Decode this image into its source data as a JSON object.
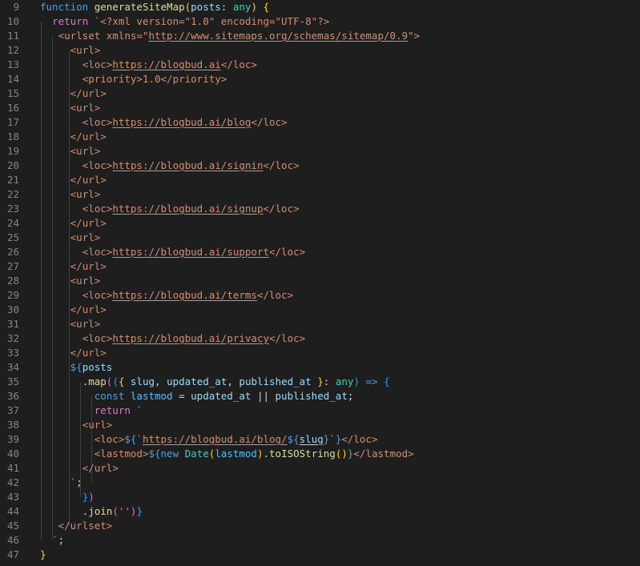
{
  "colors": {
    "keyword": "#569cd6",
    "control": "#c586c0",
    "function": "#dcdcaa",
    "variable": "#9cdcfe",
    "constant": "#4fc1ff",
    "type": "#4ec9b0",
    "string": "#ce9178",
    "tag": "#d7ba7d",
    "punct": "#d4d4d4",
    "bracket1": "#ffd700",
    "bracket2": "#da70d6",
    "bracket3": "#179fff"
  },
  "lines": [
    {
      "n": "9",
      "tokens": [
        {
          "t": "function ",
          "c": "keyword"
        },
        {
          "t": "generateSiteMap",
          "c": "function"
        },
        {
          "t": "(",
          "c": "bracket1"
        },
        {
          "t": "posts",
          "c": "variable"
        },
        {
          "t": ": ",
          "c": "punct"
        },
        {
          "t": "any",
          "c": "type"
        },
        {
          "t": ") ",
          "c": "bracket1"
        },
        {
          "t": "{",
          "c": "bracket1"
        }
      ]
    },
    {
      "n": "10",
      "tokens": [
        {
          "t": "  "
        },
        {
          "t": "return ",
          "c": "control"
        },
        {
          "t": "`<?xml version=\"1.0\" encoding=\"UTF-8\"?>",
          "c": "string"
        }
      ]
    },
    {
      "n": "11",
      "tokens": [
        {
          "t": "   "
        },
        {
          "t": "<urlset xmlns=\"",
          "c": "string"
        },
        {
          "t": "http://www.sitemaps.org/schemas/sitemap/0.9",
          "c": "string",
          "u": true
        },
        {
          "t": "\">",
          "c": "string"
        }
      ]
    },
    {
      "n": "12",
      "tokens": [
        {
          "t": "     "
        },
        {
          "t": "<url>",
          "c": "string"
        }
      ]
    },
    {
      "n": "13",
      "tokens": [
        {
          "t": "       "
        },
        {
          "t": "<loc>",
          "c": "string"
        },
        {
          "t": "https://blogbud.ai",
          "c": "string",
          "u": true
        },
        {
          "t": "</loc>",
          "c": "string"
        }
      ]
    },
    {
      "n": "14",
      "tokens": [
        {
          "t": "       "
        },
        {
          "t": "<priority>1.0</priority>",
          "c": "string"
        }
      ]
    },
    {
      "n": "15",
      "tokens": [
        {
          "t": "     "
        },
        {
          "t": "</url>",
          "c": "string"
        }
      ]
    },
    {
      "n": "16",
      "tokens": [
        {
          "t": "     "
        },
        {
          "t": "<url>",
          "c": "string"
        }
      ]
    },
    {
      "n": "17",
      "tokens": [
        {
          "t": "       "
        },
        {
          "t": "<loc>",
          "c": "string"
        },
        {
          "t": "https://blogbud.ai/blog",
          "c": "string",
          "u": true
        },
        {
          "t": "</loc>",
          "c": "string"
        }
      ]
    },
    {
      "n": "18",
      "tokens": [
        {
          "t": "     "
        },
        {
          "t": "</url>",
          "c": "string"
        }
      ]
    },
    {
      "n": "19",
      "tokens": [
        {
          "t": "     "
        },
        {
          "t": "<url>",
          "c": "string"
        }
      ]
    },
    {
      "n": "20",
      "tokens": [
        {
          "t": "       "
        },
        {
          "t": "<loc>",
          "c": "string"
        },
        {
          "t": "https://blogbud.ai/signin",
          "c": "string",
          "u": true
        },
        {
          "t": "</loc>",
          "c": "string"
        }
      ]
    },
    {
      "n": "21",
      "tokens": [
        {
          "t": "     "
        },
        {
          "t": "</url>",
          "c": "string"
        }
      ]
    },
    {
      "n": "22",
      "tokens": [
        {
          "t": "     "
        },
        {
          "t": "<url>",
          "c": "string"
        }
      ]
    },
    {
      "n": "23",
      "tokens": [
        {
          "t": "       "
        },
        {
          "t": "<loc>",
          "c": "string"
        },
        {
          "t": "https://blogbud.ai/signup",
          "c": "string",
          "u": true
        },
        {
          "t": "</loc>",
          "c": "string"
        }
      ]
    },
    {
      "n": "24",
      "tokens": [
        {
          "t": "     "
        },
        {
          "t": "</url>",
          "c": "string"
        }
      ]
    },
    {
      "n": "25",
      "tokens": [
        {
          "t": "     "
        },
        {
          "t": "<url>",
          "c": "string"
        }
      ]
    },
    {
      "n": "26",
      "tokens": [
        {
          "t": "       "
        },
        {
          "t": "<loc>",
          "c": "string"
        },
        {
          "t": "https://blogbud.ai/support",
          "c": "string",
          "u": true
        },
        {
          "t": "</loc>",
          "c": "string"
        }
      ]
    },
    {
      "n": "27",
      "tokens": [
        {
          "t": "     "
        },
        {
          "t": "</url>",
          "c": "string"
        }
      ]
    },
    {
      "n": "28",
      "tokens": [
        {
          "t": "     "
        },
        {
          "t": "<url>",
          "c": "string"
        }
      ]
    },
    {
      "n": "29",
      "tokens": [
        {
          "t": "       "
        },
        {
          "t": "<loc>",
          "c": "string"
        },
        {
          "t": "https://blogbud.ai/terms",
          "c": "string",
          "u": true
        },
        {
          "t": "</loc>",
          "c": "string"
        }
      ]
    },
    {
      "n": "30",
      "tokens": [
        {
          "t": "     "
        },
        {
          "t": "</url>",
          "c": "string"
        }
      ]
    },
    {
      "n": "31",
      "tokens": [
        {
          "t": "     "
        },
        {
          "t": "<url>",
          "c": "string"
        }
      ]
    },
    {
      "n": "32",
      "tokens": [
        {
          "t": "       "
        },
        {
          "t": "<loc>",
          "c": "string"
        },
        {
          "t": "https://blogbud.ai/privacy",
          "c": "string",
          "u": true
        },
        {
          "t": "</loc>",
          "c": "string"
        }
      ]
    },
    {
      "n": "33",
      "tokens": [
        {
          "t": "     "
        },
        {
          "t": "</url>",
          "c": "string"
        }
      ]
    },
    {
      "n": "34",
      "tokens": [
        {
          "t": "     "
        },
        {
          "t": "${",
          "c": "keyword"
        },
        {
          "t": "posts",
          "c": "variable"
        }
      ]
    },
    {
      "n": "35",
      "tokens": [
        {
          "t": "       "
        },
        {
          "t": ".",
          "c": "punct"
        },
        {
          "t": "map",
          "c": "function"
        },
        {
          "t": "(",
          "c": "bracket2"
        },
        {
          "t": "(",
          "c": "bracket3"
        },
        {
          "t": "{ ",
          "c": "bracket1"
        },
        {
          "t": "slug",
          "c": "variable"
        },
        {
          "t": ", ",
          "c": "punct"
        },
        {
          "t": "updated_at",
          "c": "variable"
        },
        {
          "t": ", ",
          "c": "punct"
        },
        {
          "t": "published_at",
          "c": "variable"
        },
        {
          "t": " }",
          "c": "bracket1"
        },
        {
          "t": ": ",
          "c": "punct"
        },
        {
          "t": "any",
          "c": "type"
        },
        {
          "t": ")",
          "c": "bracket3"
        },
        {
          "t": " => ",
          "c": "keyword"
        },
        {
          "t": "{",
          "c": "bracket3"
        }
      ]
    },
    {
      "n": "36",
      "tokens": [
        {
          "t": "         "
        },
        {
          "t": "const ",
          "c": "keyword"
        },
        {
          "t": "lastmod",
          "c": "constant"
        },
        {
          "t": " = ",
          "c": "punct"
        },
        {
          "t": "updated_at",
          "c": "variable"
        },
        {
          "t": " || ",
          "c": "punct"
        },
        {
          "t": "published_at",
          "c": "variable"
        },
        {
          "t": ";",
          "c": "punct"
        }
      ]
    },
    {
      "n": "37",
      "tokens": [
        {
          "t": "         "
        },
        {
          "t": "return ",
          "c": "control"
        },
        {
          "t": "`",
          "c": "string"
        }
      ]
    },
    {
      "n": "38",
      "tokens": [
        {
          "t": "       "
        },
        {
          "t": "<url>",
          "c": "string"
        }
      ]
    },
    {
      "n": "39",
      "tokens": [
        {
          "t": "         "
        },
        {
          "t": "<loc>",
          "c": "string"
        },
        {
          "t": "${",
          "c": "keyword"
        },
        {
          "t": "`",
          "c": "string"
        },
        {
          "t": "https://blogbud.ai/blog/",
          "c": "string",
          "u": true
        },
        {
          "t": "${",
          "c": "keyword"
        },
        {
          "t": "slug",
          "c": "variable",
          "u": true
        },
        {
          "t": "}",
          "c": "keyword"
        },
        {
          "t": "`",
          "c": "string"
        },
        {
          "t": "}",
          "c": "keyword"
        },
        {
          "t": "</loc>",
          "c": "string"
        }
      ]
    },
    {
      "n": "40",
      "tokens": [
        {
          "t": "         "
        },
        {
          "t": "<lastmod>",
          "c": "string"
        },
        {
          "t": "${",
          "c": "keyword"
        },
        {
          "t": "new ",
          "c": "keyword"
        },
        {
          "t": "Date",
          "c": "type"
        },
        {
          "t": "(",
          "c": "bracket1"
        },
        {
          "t": "lastmod",
          "c": "constant"
        },
        {
          "t": ")",
          "c": "bracket1"
        },
        {
          "t": ".",
          "c": "punct"
        },
        {
          "t": "toISOString",
          "c": "function"
        },
        {
          "t": "()",
          "c": "bracket1"
        },
        {
          "t": "}",
          "c": "keyword"
        },
        {
          "t": "</lastmod>",
          "c": "string"
        }
      ]
    },
    {
      "n": "41",
      "tokens": [
        {
          "t": "       "
        },
        {
          "t": "</url>",
          "c": "string"
        }
      ]
    },
    {
      "n": "42",
      "tokens": [
        {
          "t": "     "
        },
        {
          "t": "`",
          "c": "string"
        },
        {
          "t": ";",
          "c": "punct"
        }
      ]
    },
    {
      "n": "43",
      "tokens": [
        {
          "t": "       "
        },
        {
          "t": "}",
          "c": "bracket3"
        },
        {
          "t": ")",
          "c": "bracket2"
        }
      ]
    },
    {
      "n": "44",
      "tokens": [
        {
          "t": "       "
        },
        {
          "t": ".",
          "c": "punct"
        },
        {
          "t": "join",
          "c": "function"
        },
        {
          "t": "(",
          "c": "bracket2"
        },
        {
          "t": "''",
          "c": "string"
        },
        {
          "t": ")",
          "c": "bracket2"
        },
        {
          "t": "}",
          "c": "keyword"
        }
      ]
    },
    {
      "n": "45",
      "tokens": [
        {
          "t": "   "
        },
        {
          "t": "</urlset>",
          "c": "string"
        }
      ]
    },
    {
      "n": "46",
      "tokens": [
        {
          "t": "  "
        },
        {
          "t": "`",
          "c": "string"
        },
        {
          "t": ";",
          "c": "punct"
        }
      ]
    },
    {
      "n": "47",
      "tokens": [
        {
          "t": "}",
          "c": "bracket1"
        }
      ]
    }
  ]
}
